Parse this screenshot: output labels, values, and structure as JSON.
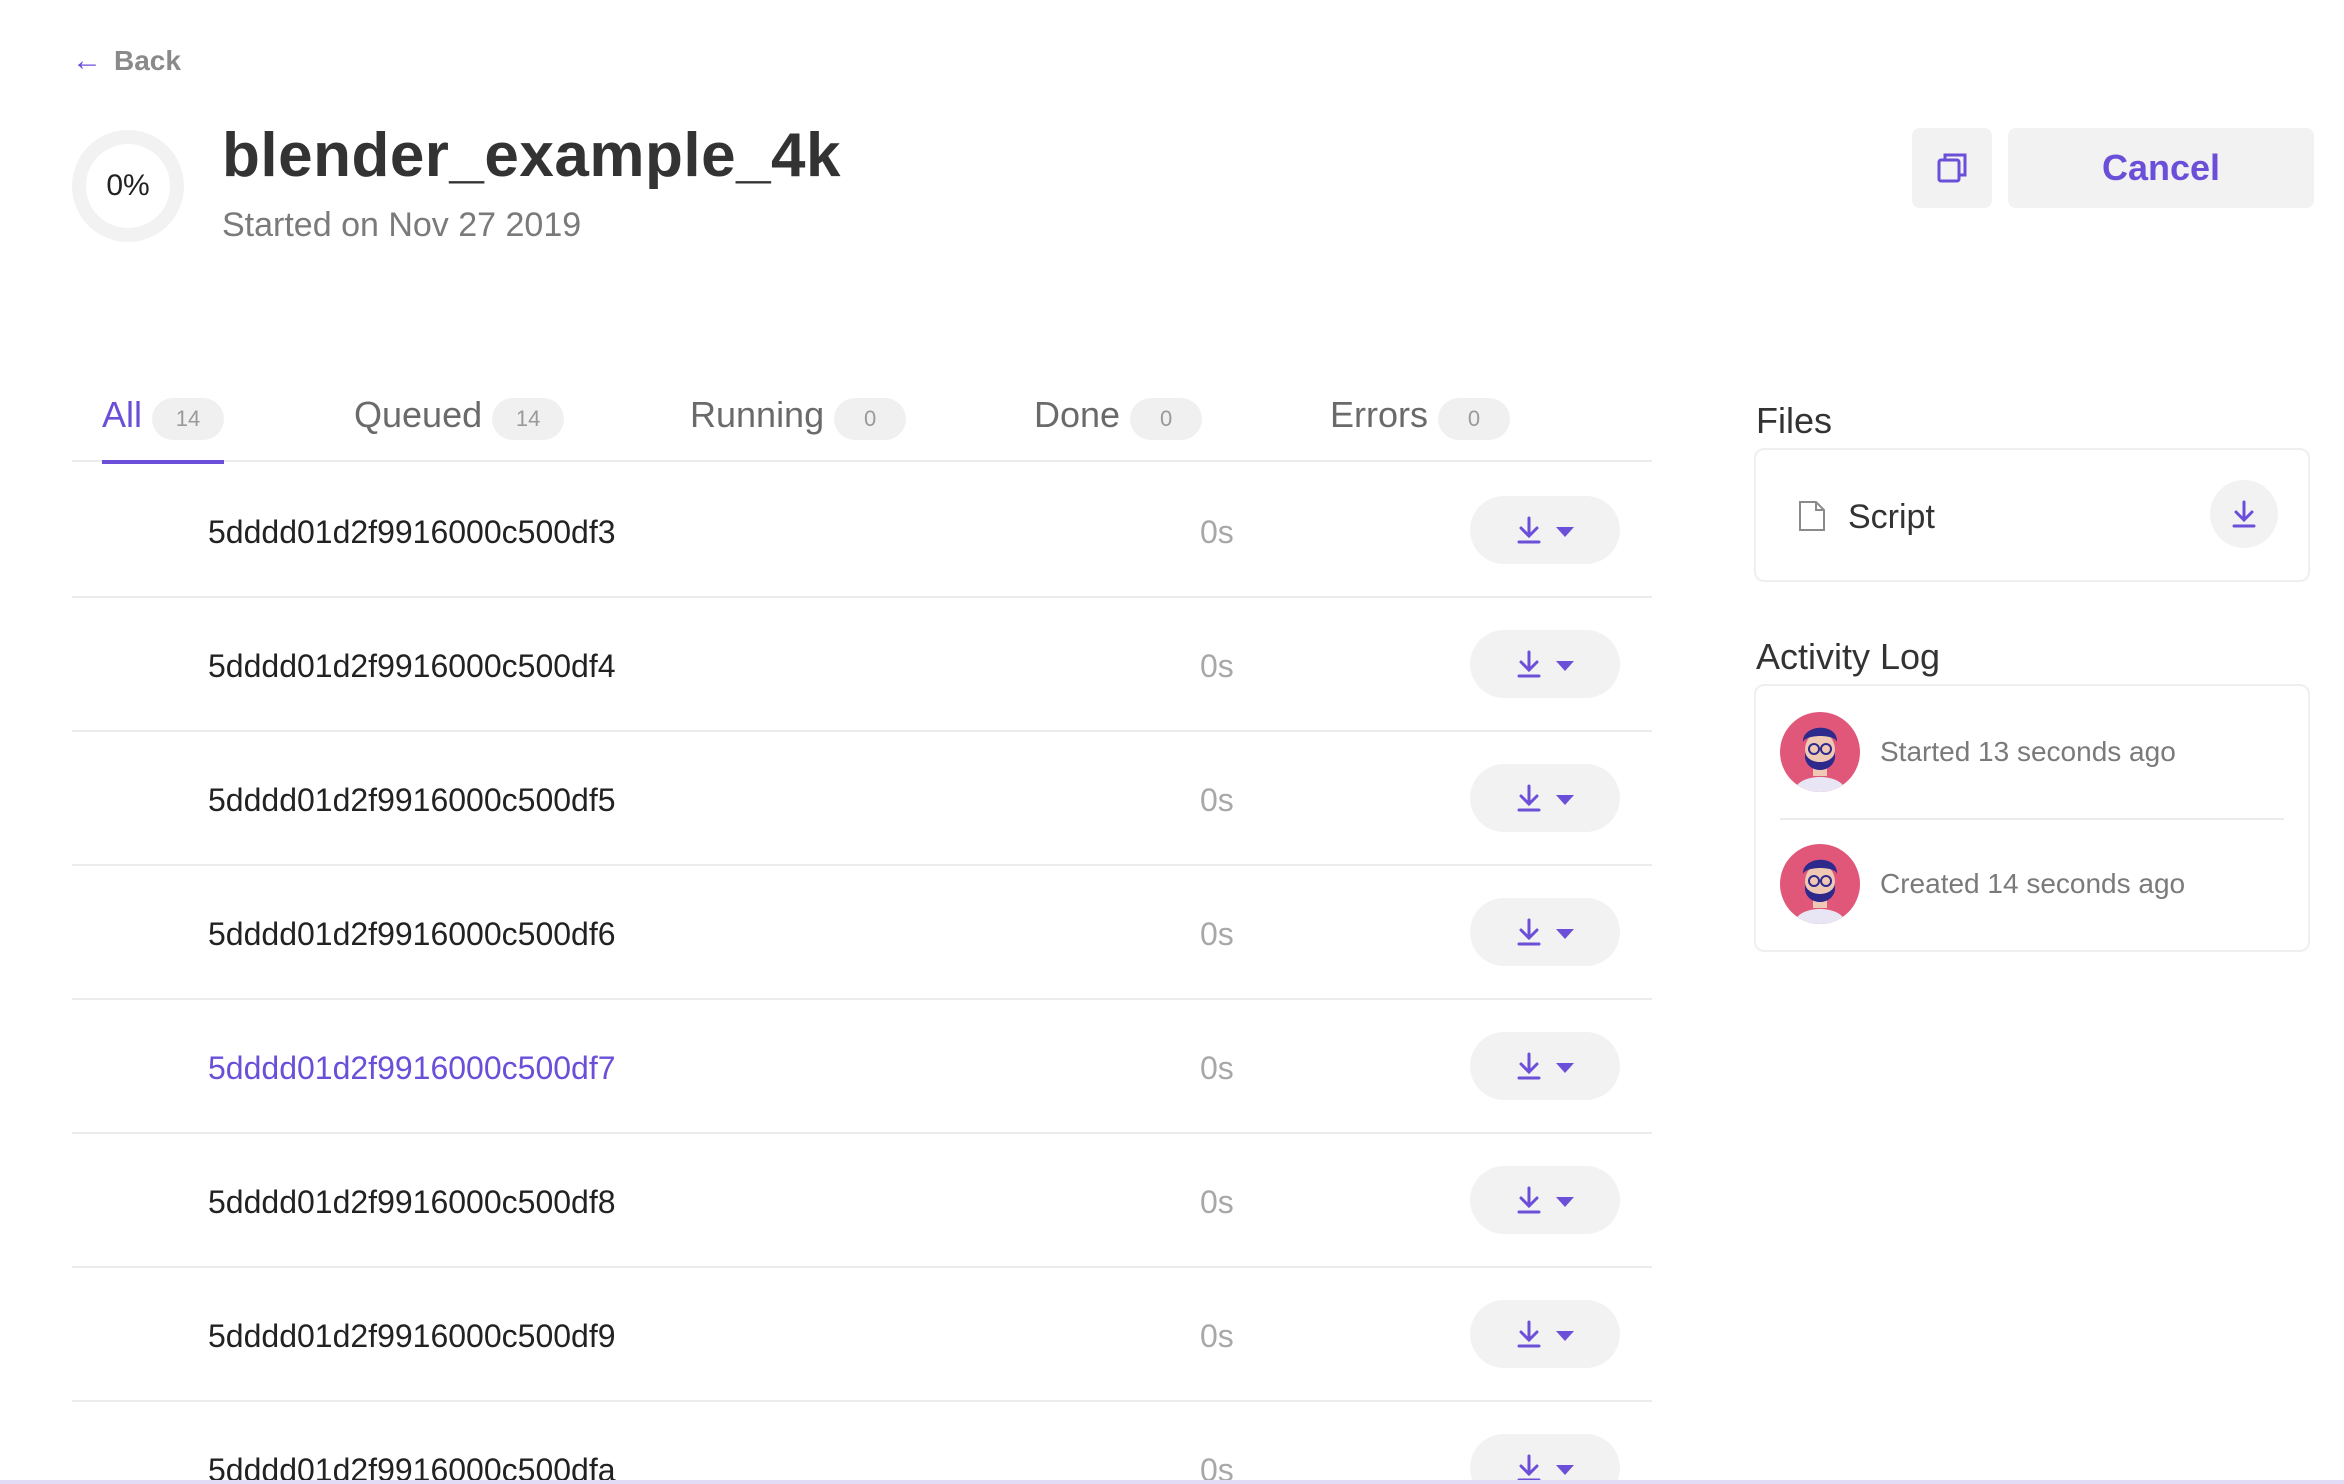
{
  "nav": {
    "back_label": "Back"
  },
  "job": {
    "progress": "0%",
    "title": "blender_example_4k",
    "subtitle": "Started on Nov 27 2019"
  },
  "actions": {
    "cancel_label": "Cancel"
  },
  "tabs": [
    {
      "label": "All",
      "count": "14",
      "active": true
    },
    {
      "label": "Queued",
      "count": "14"
    },
    {
      "label": "Running",
      "count": "0"
    },
    {
      "label": "Done",
      "count": "0"
    },
    {
      "label": "Errors",
      "count": "0"
    }
  ],
  "tasks": [
    {
      "id": "5dddd01d2f9916000c500df3",
      "duration": "0s"
    },
    {
      "id": "5dddd01d2f9916000c500df4",
      "duration": "0s"
    },
    {
      "id": "5dddd01d2f9916000c500df5",
      "duration": "0s"
    },
    {
      "id": "5dddd01d2f9916000c500df6",
      "duration": "0s"
    },
    {
      "id": "5dddd01d2f9916000c500df7",
      "duration": "0s",
      "highlighted": true
    },
    {
      "id": "5dddd01d2f9916000c500df8",
      "duration": "0s"
    },
    {
      "id": "5dddd01d2f9916000c500df9",
      "duration": "0s"
    },
    {
      "id": "5dddd01d2f9916000c500dfa",
      "duration": "0s"
    }
  ],
  "files": {
    "title": "Files",
    "items": [
      {
        "name": "Script",
        "icon": "file-icon"
      }
    ]
  },
  "activity": {
    "title": "Activity Log",
    "items": [
      {
        "text": "Started 13 seconds ago",
        "icon": "avatar"
      },
      {
        "text": "Created 14 seconds ago",
        "icon": "avatar"
      }
    ]
  },
  "colors": {
    "accent": "#6b4fd8",
    "avatar_bg": "#e0577a",
    "button_bg": "#f2f2f2"
  }
}
